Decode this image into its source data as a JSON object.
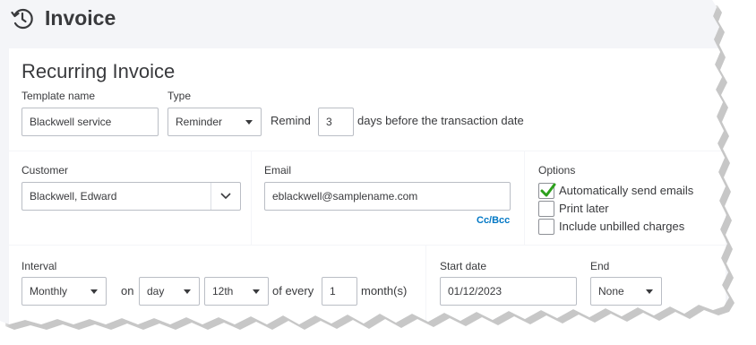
{
  "header": {
    "title": "Invoice",
    "icon": "recurring-clock-icon"
  },
  "section": {
    "title": "Recurring Invoice"
  },
  "template": {
    "name_label": "Template name",
    "name_value": "Blackwell service",
    "type_label": "Type",
    "type_value": "Reminder",
    "remind_prefix": "Remind",
    "remind_days": "3",
    "remind_suffix": "days before the transaction date"
  },
  "customer": {
    "label": "Customer",
    "value": "Blackwell, Edward"
  },
  "email": {
    "label": "Email",
    "value": "eblackwell@samplename.com",
    "cc_bcc": "Cc/Bcc"
  },
  "options": {
    "label": "Options",
    "items": [
      {
        "label": "Automatically send emails",
        "checked": true
      },
      {
        "label": "Print later",
        "checked": false
      },
      {
        "label": "Include unbilled charges",
        "checked": false
      }
    ],
    "check_color": "#2ca01c"
  },
  "interval": {
    "label": "Interval",
    "frequency": "Monthly",
    "on_label": "on",
    "day_type": "day",
    "day_value": "12th",
    "of_every_label": "of every",
    "every_value": "1",
    "unit_label": "month(s)"
  },
  "dates": {
    "start_label": "Start date",
    "start_value": "01/12/2023",
    "end_label": "End",
    "end_value": "None"
  }
}
